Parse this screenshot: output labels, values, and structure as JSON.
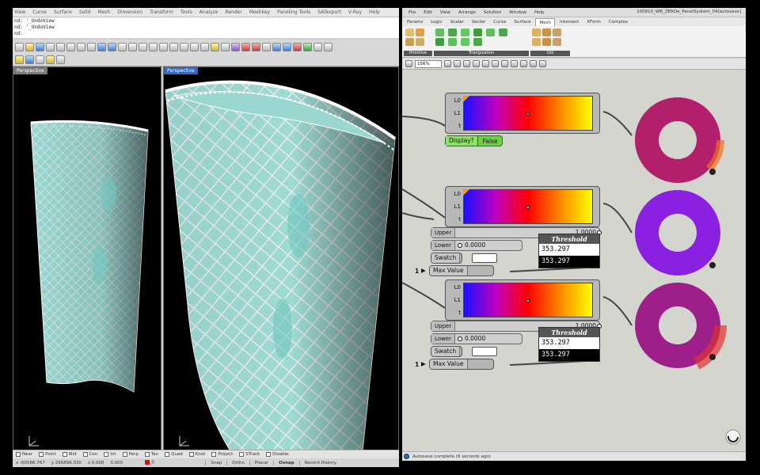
{
  "rhino": {
    "menu": [
      "View",
      "Curve",
      "Surface",
      "Solid",
      "Mesh",
      "Dimension",
      "Transform",
      "Tools",
      "Analyze",
      "Render",
      "Meshkey",
      "Paneling Tools",
      "SATexport",
      "V-Ray",
      "Help"
    ],
    "command_history": [
      "nd: '_UndoView",
      "nd: '_UndoView",
      "nd:"
    ],
    "viewports": {
      "left_title": "Perspective",
      "right_title": "Perspective"
    },
    "osnaps": [
      "Near",
      "Point",
      "Mid",
      "Cen",
      "Int",
      "Perp",
      "Tan",
      "Quad",
      "Knot",
      "Project",
      "STrack",
      "Disable"
    ],
    "status": {
      "x": "x -60586.767",
      "y": "y 296896.330",
      "z": "z 0.000",
      "extra": "0.000",
      "layer": "0",
      "panes": [
        "Snap",
        "Ortho",
        "Planar",
        "Osnap",
        "Record History"
      ],
      "active_pane": "Osnap"
    }
  },
  "grasshopper": {
    "menu": [
      "File",
      "Edit",
      "View",
      "Arrange",
      "Solution",
      "Window",
      "Help"
    ],
    "document_title": "100910_WB_ZEROe_PanelSystem_04[autosave]",
    "tabs": [
      "Params",
      "Logic",
      "Scalar",
      "Vector",
      "Curve",
      "Surface",
      "Mesh",
      "Intersect",
      "XForm",
      "Complex"
    ],
    "active_tab": "Mesh",
    "ribbon_groups": [
      "Primitive",
      "Triangulation",
      "Util"
    ],
    "zoom": "156%",
    "status_message": "Autosave complete (6 seconds ago)",
    "gradient_inputs": [
      "L0",
      "L1",
      "t"
    ],
    "toggle": {
      "label": "Display?",
      "value": "False"
    },
    "group2": {
      "upper_label": "Upper",
      "upper_value": "1.0000",
      "lower_label": "Lower",
      "lower_value": "0.0000",
      "swatch_label": "Swatch",
      "max_label": "Max Value",
      "max_count": "1",
      "panel_title": "Threshold",
      "panel_values": [
        "353.297",
        "353.297"
      ]
    },
    "group3": {
      "upper_label": "Upper",
      "upper_value": "1.0000",
      "lower_label": "Lower",
      "lower_value": "0.0000",
      "swatch_label": "Swatch",
      "max_label": "Max Value",
      "max_count": "1",
      "panel_title": "Threshold",
      "panel_values": [
        "353.297",
        "353.297"
      ]
    }
  },
  "colors": {
    "gradient": [
      "#1a10ff",
      "#c000c0",
      "#ff0000",
      "#ff8800",
      "#ffff00"
    ],
    "ring_purple": "#8a20e0",
    "ring_magenta": "#c0207a",
    "toggle_green": "#6fd04a",
    "rhino_active_viewport": "#2b6acb"
  }
}
